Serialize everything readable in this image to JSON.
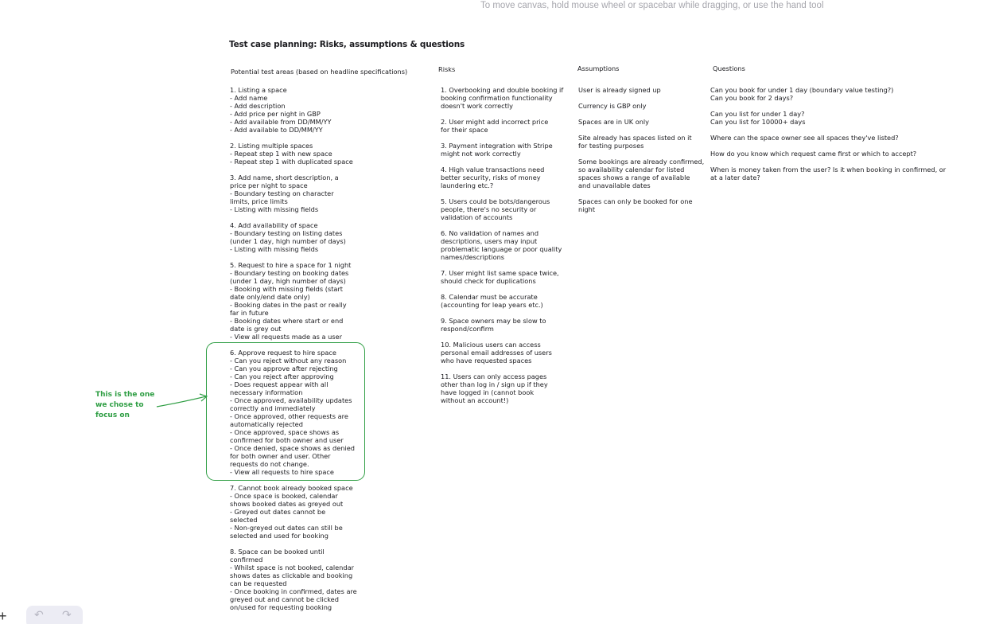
{
  "canvas_hint": "To move canvas, hold mouse wheel or spacebar while dragging, or use the hand tool",
  "title": "Test case planning: Risks, assumptions & questions",
  "columns": {
    "test_areas": {
      "heading": "Potential test areas (based on headline specifications)",
      "items": [
        "1. Listing a space\n- Add name\n- Add description\n- Add price per night in GBP\n- Add available from DD/MM/YY\n- Add available to DD/MM/YY",
        "2. Listing multiple spaces\n- Repeat step 1 with new space\n- Repeat step 1 with duplicated space",
        "3. Add name, short description, a\nprice per night to space\n- Boundary testing on character\nlimits, price limits\n- Listing with missing fields",
        "4. Add availability of space\n- Boundary testing on listing dates\n(under 1 day, high number of days)\n- Listing with missing fields",
        "5. Request to hire a space for 1 night\n- Boundary testing on booking dates\n(under 1 day, high number of days)\n- Booking with missing fields (start\ndate only/end date only)\n- Booking dates in the past or really\nfar in future\n- Booking dates where start or end\ndate is grey out\n- View all requests made as a user",
        "6. Approve request to hire space\n- Can you reject without any reason\n- Can you approve after rejecting\n- Can you reject after approving\n- Does request appear with all\nnecessary information\n- Once approved, availability updates\ncorrectly and immediately\n- Once approved, other requests are\nautomatically rejected\n- Once approved, space shows as\nconfirmed for both owner and user\n- Once denied, space shows as denied\nfor both owner and user. Other\nrequests do not change.\n- View all requests to hire space",
        "7. Cannot book already booked space\n- Once space is booked, calendar\nshows booked dates as greyed out\n- Greyed out dates cannot be\nselected\n- Non-greyed out dates can still be\nselected and used for booking",
        "8. Space can be booked until\nconfirmed\n- Whilst space is not booked, calendar\nshows dates as clickable and booking\ncan be requested\n- Once booking in confirmed, dates are\ngreyed out and cannot be clicked\non/used for requesting booking"
      ]
    },
    "risks": {
      "heading": "Risks",
      "items": [
        "1. Overbooking and double booking if\nbooking confirmation functionality\ndoesn't work correctly",
        "2. User might add incorrect price\nfor their space",
        "3. Payment integration with Stripe\nmight not work correctly",
        "4. High value transactions need\nbetter security, risks of money\nlaundering etc.?",
        "5. Users could be bots/dangerous\npeople, there's no security or\nvalidation of accounts",
        "6. No validation of names and\ndescriptions, users may input\nproblematic language or poor quality\nnames/descriptions",
        "7. User might list same space twice,\nshould check for duplications",
        "8. Calendar must be accurate\n(accounting for leap years etc.)",
        "9. Space owners may be slow to\nrespond/confirm",
        "10. Malicious users can access\npersonal email addresses of users\nwho have requested spaces",
        "11. Users can only access pages\nother than log in / sign up if they\nhave logged in (cannot book\nwithout an account!)"
      ]
    },
    "assumptions": {
      "heading": "Assumptions",
      "items": [
        "User is already signed up",
        "Currency is GBP only",
        "Spaces are in UK only",
        "Site already has spaces listed on it\nfor testing purposes",
        "Some bookings are already confirmed,\nso availability calendar for listed\nspaces shows a range of available\nand unavailable dates",
        "Spaces can only be booked for one\nnight"
      ]
    },
    "questions": {
      "heading": "Questions",
      "items": [
        "Can you book for under 1 day (boundary value testing?)\nCan you book for 2 days?",
        "Can you list for under 1 day?\nCan you list for 10000+ days",
        "Where can the space owner see all spaces they've listed?",
        "How do you know which request came first or which to accept?",
        "When is money taken from the user? Is it when booking in confirmed, or\nat a later date?"
      ]
    }
  },
  "callout": "This is the one\nwe chose to\nfocus on",
  "accent_color": "#2f9e44",
  "toolbar": {
    "add": "+",
    "undo": "↶",
    "redo": "↷"
  }
}
